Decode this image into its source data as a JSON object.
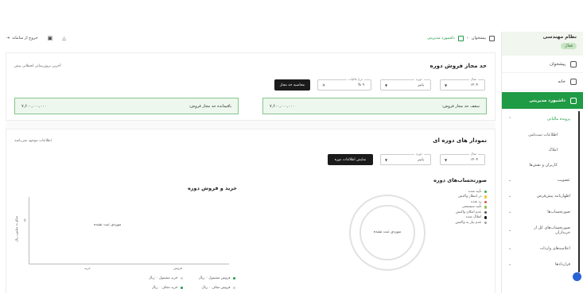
{
  "sidebar": {
    "title": "نظام مهندسی",
    "badge": "فعال",
    "items": [
      {
        "label": "پیشخوان"
      },
      {
        "label": "خانه"
      },
      {
        "label": "داشبورد مدیریتی"
      }
    ],
    "submenu_group": "پرونده مالیاتی",
    "submenu_leaves": [
      "اطلاعات ثبت‌نامی",
      "املاک",
      "کاربران و نقش‌ها"
    ],
    "more_items": [
      {
        "label": "عضویت"
      },
      {
        "label": "اظهارنامه پیش‌فرض"
      },
      {
        "label": "صورتحساب‌ها"
      },
      {
        "label": "صورتحساب‌های کل از خریداران"
      },
      {
        "label": "اعلامیه‌های واردات"
      },
      {
        "label": "قراردادها"
      }
    ]
  },
  "topbar": {
    "crumb_home": "پیشخوان",
    "crumb_current": "داشبورد مدیریتی",
    "logout": "خروج از سامانه"
  },
  "card1": {
    "title": "حد مجاز فروش دوره",
    "note": "آخرین بروزرسانی لحظاتی پیش",
    "year_label": "سال",
    "year_value": "۱۴۰۴",
    "period_label": "دوره",
    "period_value": "پاییز",
    "rate_label": "نرخ مالیات",
    "rate_value": "۹ %",
    "calc_button": "محاسبه حد مجاز",
    "ceiling_label": "سقف حد مجاز فروش:",
    "ceiling_value": "۷,۶۰۰,۰۰۰,۰۰۰",
    "remaining_label": "باقیمانده حد مجاز فروش:",
    "remaining_value": "۷,۶۰۰,۰۰۰,۰۰۰"
  },
  "card2": {
    "title": "نمودار های دوره ای",
    "note": "اطلاعات موجود نمی‌باشد",
    "year_label": "سال",
    "year_value": "۱۴۰۴",
    "period_label": "دوره",
    "period_value": "پاییز",
    "show_button": "نمایش اطلاعات دوره",
    "invoices_title": "صورتحساب‌های دوره",
    "legend": [
      {
        "label": "تأیید شده",
        "color": "#2bb24c"
      },
      {
        "label": "در انتظار واکنش",
        "color": "#f2c037"
      },
      {
        "label": "رد شده",
        "color": "#e0533d"
      },
      {
        "label": "تأیید سیستمی",
        "color": "#8bc34a"
      },
      {
        "label": "عدم امکان واکنش",
        "color": "#555555"
      },
      {
        "label": "ابطال شده",
        "color": "#1b1b1b"
      },
      {
        "label": "عدم نیاز به واکنش",
        "color": "#9e9e9e"
      }
    ],
    "donut_empty": "موردی ثبت نشده",
    "chart_title": "خرید و فروش دوره",
    "chart_empty": "موردی ثبت نشده",
    "ylabel": "مبالغ به میلیون ریال",
    "tick_zero": "0",
    "x_categories": [
      "فروش",
      "خرید"
    ],
    "bottom_legend": [
      {
        "label": "فروش مشمول ۰ ریال",
        "color": "#1f9a45"
      },
      {
        "label": "خرید مشمول ۰ ریال",
        "color": "#1f9a45"
      },
      {
        "label": "فروش معاف ۰ ریال",
        "color": "#1f9a45"
      },
      {
        "label": "خرید معاف ۰ ریال",
        "color": "#1f9a45"
      }
    ]
  }
}
